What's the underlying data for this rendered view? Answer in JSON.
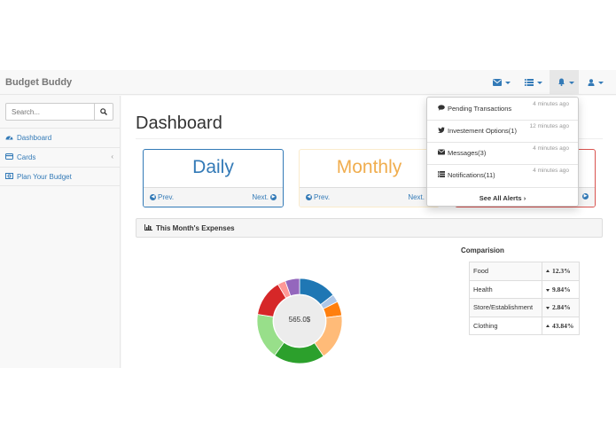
{
  "navbar": {
    "brand": "Budget Buddy",
    "icons": [
      "envelope-icon",
      "tasks-icon",
      "bell-icon",
      "user-icon"
    ]
  },
  "sidebar": {
    "search_placeholder": "Search...",
    "items": [
      {
        "label": "Dashboard",
        "icon": "dashboard-icon"
      },
      {
        "label": "Cards",
        "icon": "credit-card-icon"
      },
      {
        "label": "Plan Your Budget",
        "icon": "money-icon"
      }
    ]
  },
  "main": {
    "title": "Dashboard",
    "panels": [
      {
        "title": "Daily",
        "prev": "Prev.",
        "next": "Next.",
        "color": "#337ab7",
        "border": "#337ab7"
      },
      {
        "title": "Monthly",
        "prev": "Prev.",
        "next": "Next.",
        "color": "#f0ad4e",
        "border": "#faebcc"
      },
      {
        "title": "",
        "prev": "",
        "next": "",
        "color": "#d9534f",
        "border": "#d9534f"
      }
    ],
    "expenses_title": "This Month's Expenses",
    "donut": {
      "center_label": "565.0$",
      "segments": [
        {
          "color": "#1f77b4",
          "fraction": 0.145
        },
        {
          "color": "#aec7e8",
          "fraction": 0.03
        },
        {
          "color": "#ff7f0e",
          "fraction": 0.055
        },
        {
          "color": "#ffbb78",
          "fraction": 0.175
        },
        {
          "color": "#2ca02c",
          "fraction": 0.195
        },
        {
          "color": "#98df8a",
          "fraction": 0.175
        },
        {
          "color": "#d62728",
          "fraction": 0.14
        },
        {
          "color": "#ff9896",
          "fraction": 0.03
        },
        {
          "color": "#9467bd",
          "fraction": 0.055
        }
      ]
    },
    "comparison": {
      "title": "Comparision",
      "rows": [
        {
          "category": "Food",
          "direction": "up",
          "value": "12.3%"
        },
        {
          "category": "Health",
          "direction": "down",
          "value": "9.84%"
        },
        {
          "category": "Store/Establishment",
          "direction": "down",
          "value": "2.84%"
        },
        {
          "category": "Clothing",
          "direction": "up",
          "value": "43.84%"
        }
      ]
    }
  },
  "alerts": {
    "items": [
      {
        "label": "Pending Transactions",
        "time": "4 minutes ago",
        "icon": "comment-icon"
      },
      {
        "label": "Investement Options(1)",
        "time": "12 minutes ago",
        "icon": "twitter-icon"
      },
      {
        "label": "Messages(3)",
        "time": "4 minutes ago",
        "icon": "envelope-icon"
      },
      {
        "label": "Notifications(11)",
        "time": "4 minutes ago",
        "icon": "tasks-icon"
      }
    ],
    "see_all": "See All Alerts"
  },
  "colors": {
    "link": "#337ab7",
    "daily": "#337ab7",
    "monthly": "#f0ad4e",
    "third_panel": "#d9534f"
  }
}
